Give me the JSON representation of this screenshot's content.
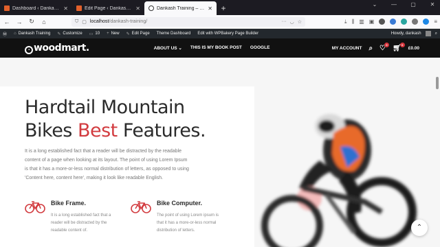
{
  "browser": {
    "tabs": [
      {
        "title": "Dashboard ‹ Dankash Training —",
        "active": false
      },
      {
        "title": "Edit Page ‹ Dankash Training —",
        "active": false
      },
      {
        "title": "Dankash Training – Just anothe",
        "active": true
      }
    ],
    "new_tab": "+",
    "window_controls": [
      "⌄",
      "—",
      "▢",
      "✕"
    ],
    "url_host": "localhost",
    "url_path": "/dankash-training/"
  },
  "wp_admin": {
    "site_name": "Dankash Training",
    "customize": "Customize",
    "comments_count": "10",
    "new": "New",
    "edit_page": "Edit Page",
    "theme_dashboard": "Theme Dashboard",
    "wpbakery": "Edit with WPBakery Page Builder",
    "howdy": "Howdy, dankash"
  },
  "header": {
    "logo": "woodmart.",
    "menu": [
      "ABOUT US ⌄",
      "THIS IS MY BOOK POST",
      "GOOGLE"
    ],
    "my_account": "MY ACCOUNT",
    "wishlist_count": "0",
    "cart_count": "0",
    "cart_total": "£0.00"
  },
  "hero": {
    "line1": "Hardtail Mountain",
    "line2_pre": "Bikes ",
    "line2_red": "Best",
    "line2_post": " Features.",
    "paragraph": "It is a long established fact that a reader will be distracted by the readable content of a page when looking at its layout. The point of using Lorem Ipsum is that it has a more-or-less normal distribution of letters, as opposed to using 'Content here, content here', making it look like readable English."
  },
  "features": [
    {
      "title": "Bike Frame.",
      "desc": "It is a long established fact that a reader will be distracted by the readable content of.",
      "icon": "bicycle-icon"
    },
    {
      "title": "Bike Computer.",
      "desc": "The point of using Lorem ipsum is that it has a more-or-less normal distribution of letters.",
      "icon": "bicycle-icon"
    }
  ],
  "colors": {
    "accent": "#d23b3f",
    "header_bg": "#111111",
    "admin_bar": "#23282d"
  }
}
